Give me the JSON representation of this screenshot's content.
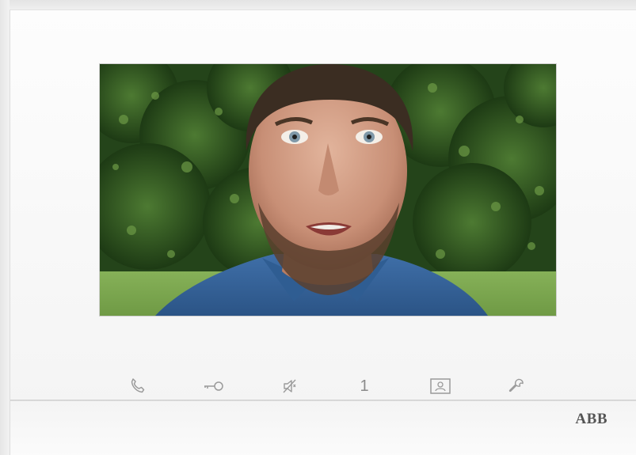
{
  "device": {
    "brand": "ABB"
  },
  "video": {
    "live_feed": "camera"
  },
  "controls": [
    {
      "name": "call",
      "icon": "phone-icon"
    },
    {
      "name": "door-release",
      "icon": "key-icon"
    },
    {
      "name": "mute",
      "icon": "speaker-mute-icon"
    },
    {
      "name": "channel",
      "icon": "number",
      "label": "1"
    },
    {
      "name": "surveillance",
      "icon": "camera-view-icon"
    },
    {
      "name": "settings",
      "icon": "wrench-icon"
    }
  ],
  "colors": {
    "icon": "#9a9a9a",
    "body": "#f7f7f7",
    "brand": "#555555"
  }
}
